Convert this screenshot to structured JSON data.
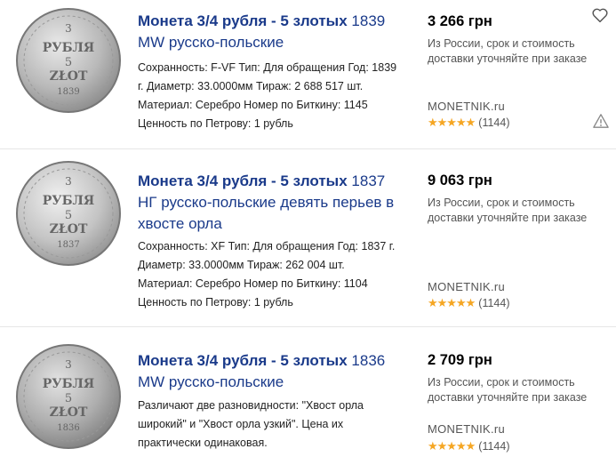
{
  "results": [
    {
      "title_bold": "Монета 3/4 рубля - 5 злотых",
      "title_year": "1839",
      "title_rest": "MW русско-польские",
      "desc_lines": [
        "Сохранность: F-VF Тип: Для обращения Год: 1839",
        "г. Диаметр: 33.0000мм Тираж: 2 688 517 шт.",
        "Материал: Серебро Номер по Биткину: 1145",
        "Ценность по Петрову: 1 рубль"
      ],
      "price": "3 266 грн",
      "delivery_line1": "Из России, срок и стоимость",
      "delivery_line2": "доставки уточняйте при заказе",
      "shop": "MONETNIK.ru",
      "stars": "★★★★★",
      "reviews": "(1144)",
      "coin_year": "1839"
    },
    {
      "title_bold": "Монета 3/4 рубля - 5 злотых",
      "title_year": "1837",
      "title_rest": "НГ русско-польские девять перьев в",
      "title_rest2": "хвосте орла",
      "desc_lines": [
        "Сохранность: XF Тип: Для обращения Год: 1837 г.",
        "Диаметр: 33.0000мм Тираж: 262 004 шт.",
        "Материал: Серебро Номер по Биткину: 1104",
        "Ценность по Петрову: 1 рубль"
      ],
      "price": "9 063 грн",
      "delivery_line1": "Из России, срок и стоимость",
      "delivery_line2": "доставки уточняйте при заказе",
      "shop": "MONETNIK.ru",
      "stars": "★★★★★",
      "reviews": "(1144)",
      "coin_year": "1837"
    },
    {
      "title_bold": "Монета 3/4 рубля - 5 злотых",
      "title_year": "1836",
      "title_rest": "MW русско-польские",
      "desc_lines": [
        "Различают две разновидности: \"Хвост орла",
        "широкий\" и \"Хвост орла узкий\". Цена их",
        "практически одинаковая."
      ],
      "price": "2 709 грн",
      "delivery_line1": "Из России, срок и стоимость",
      "delivery_line2": "доставки уточняйте при заказе",
      "shop": "MONETNIK.ru",
      "stars": "★★★★★",
      "reviews": "(1144)",
      "coin_year": "1836"
    }
  ],
  "coin_text": {
    "top": "3",
    "mid1": "РУБЛЯ",
    "mid2": "5",
    "mid3": "ZŁOT"
  },
  "icons": {
    "favorite": "heart-icon",
    "report": "warning-triangle-icon"
  },
  "colors": {
    "title": "#1a3a8a",
    "stars": "#f5a623",
    "muted": "#555555"
  }
}
